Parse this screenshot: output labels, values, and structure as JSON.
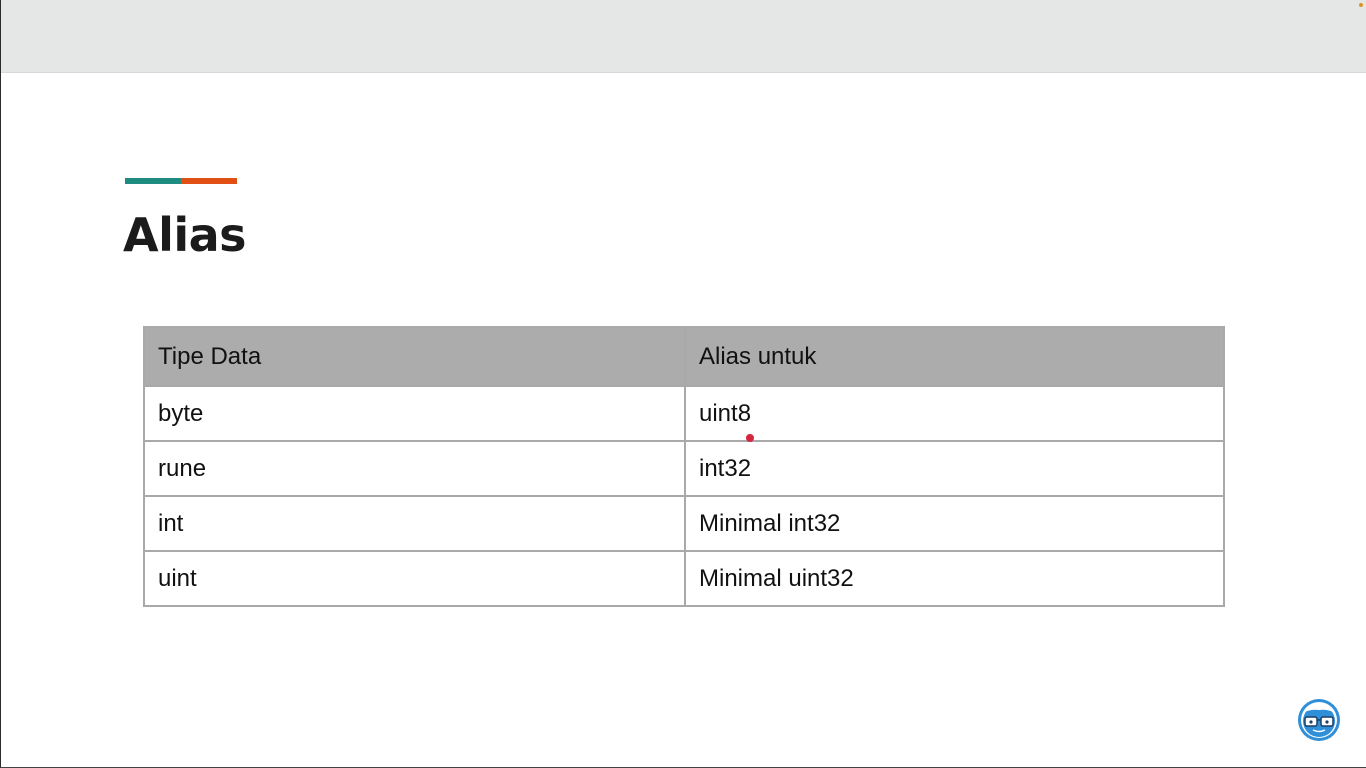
{
  "slide": {
    "title": "Alias",
    "accent_colors": [
      "#1e8c80",
      "#e04f14"
    ]
  },
  "table": {
    "headers": [
      "Tipe Data",
      "Alias untuk"
    ],
    "rows": [
      [
        "byte",
        "uint8"
      ],
      [
        "rune",
        "int32"
      ],
      [
        "int",
        "Minimal int32"
      ],
      [
        "uint",
        "Minimal uint32"
      ]
    ],
    "header_bg": "#acacac"
  },
  "logo": {
    "icon": "nerd-glasses-logo-icon",
    "color": "#2f8fd8"
  },
  "pointer": {
    "color": "#d6253f"
  }
}
